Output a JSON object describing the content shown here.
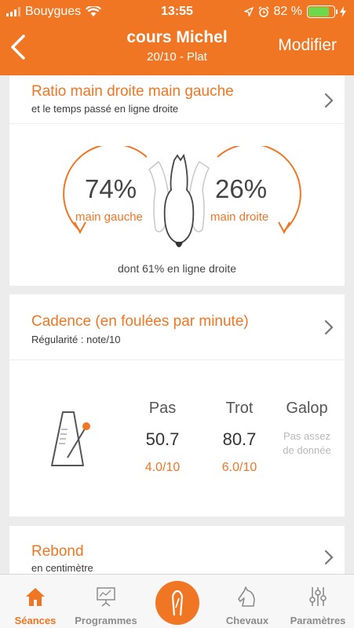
{
  "status": {
    "carrier": "Bouygues",
    "time": "13:55",
    "battery": "82 %"
  },
  "nav": {
    "title": "cours Michel",
    "subtitle": "20/10 - Plat",
    "action": "Modifier"
  },
  "ratio_card": {
    "title": "Ratio main droite main gauche",
    "subtitle": "et le temps passé en ligne droite",
    "left_pct": "74%",
    "left_label": "main gauche",
    "right_pct": "26%",
    "right_label": "main droite",
    "footnote": "dont 61% en ligne droite"
  },
  "cadence_card": {
    "title": "Cadence (en foulées par minute)",
    "subtitle": "Régularité : note/10",
    "columns": [
      {
        "name": "Pas",
        "value": "50.7",
        "note": "4.0/10"
      },
      {
        "name": "Trot",
        "value": "80.7",
        "note": "6.0/10"
      },
      {
        "name": "Galop",
        "na_line1": "Pas assez",
        "na_line2": "de donnée"
      }
    ]
  },
  "rebond_card": {
    "title": "Rebond",
    "subtitle": "en centimètre"
  },
  "tabs": [
    {
      "label": "Séances",
      "icon": "house-icon",
      "active": true
    },
    {
      "label": "Programmes",
      "icon": "presentation-board-icon"
    },
    {
      "label": "",
      "icon": "horseshoe-icon"
    },
    {
      "label": "Chevaux",
      "icon": "horse-head-icon"
    },
    {
      "label": "Paramètres",
      "icon": "sliders-icon"
    }
  ],
  "colors": {
    "accent": "#f07623",
    "battery": "#6dd84b"
  }
}
